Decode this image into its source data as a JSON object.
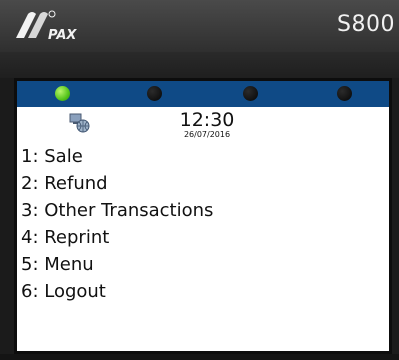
{
  "device": {
    "brand": "PAX",
    "model": "S800"
  },
  "status": {
    "time": "12:30",
    "date": "26/07/2016",
    "indicators": [
      "green",
      "off",
      "off",
      "off"
    ],
    "network_icon": "network-globe-icon"
  },
  "menu": {
    "items": [
      {
        "label": "1: Sale"
      },
      {
        "label": "2: Refund"
      },
      {
        "label": "3: Other Transactions"
      },
      {
        "label": "4: Reprint"
      },
      {
        "label": "5: Menu"
      },
      {
        "label": "6: Logout"
      }
    ]
  },
  "colors": {
    "status_bar": "#0f4a86",
    "led_active": "#55c51c",
    "screen_bg": "#ffffff"
  }
}
